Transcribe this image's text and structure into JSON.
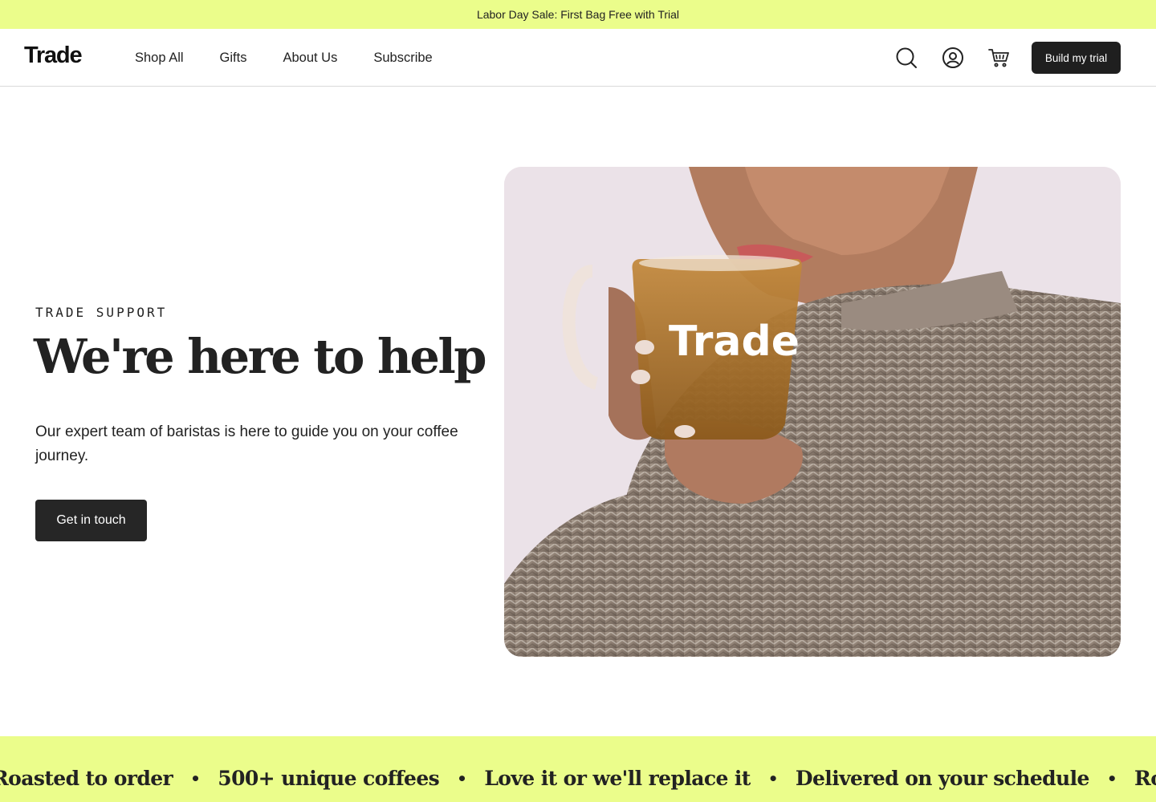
{
  "announcement": {
    "text": "Labor Day Sale: First Bag Free with Trial"
  },
  "nav": {
    "logo": "Trade",
    "links": [
      "Shop All",
      "Gifts",
      "About Us",
      "Subscribe"
    ],
    "icons": [
      "search-icon",
      "account-icon",
      "cart-icon"
    ],
    "cta_label": "Build my trial"
  },
  "hero": {
    "eyebrow": "TRADE SUPPORT",
    "title": "We're here to help",
    "subtitle": "Our expert team of baristas is here to guide you on your coffee journey.",
    "cta_label": "Get in touch",
    "image": {
      "mug_logo": "Trade"
    }
  },
  "marquee": {
    "items": [
      "Roasted to order",
      "500+ unique coffees",
      "Love it or we'll replace it",
      "Delivered on your schedule",
      "Roasted to order"
    ],
    "separator": "•"
  },
  "colors": {
    "accent_lime": "#ebfd8b",
    "dark_button": "#1f1f1f",
    "text": "#222222"
  }
}
